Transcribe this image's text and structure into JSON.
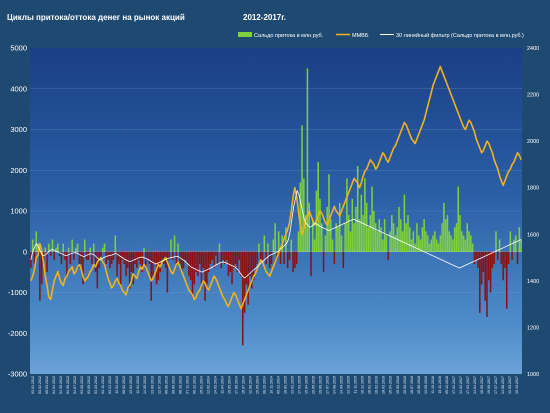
{
  "chart_data": {
    "type": "bar",
    "title": "Циклы притока/оттока денег на рынок акций",
    "subtitle": "2012-2017г.",
    "legend": {
      "placement": "top-right",
      "entries": [
        {
          "label": "Сальдо притока в млн.руб.",
          "color": "#7fd13b"
        },
        {
          "label": "ММВБ",
          "color": "#f2b21b"
        },
        {
          "label": "30 линейный фильтр (Сальдо притока в млн.руб.)",
          "color": "#ffffff"
        }
      ]
    },
    "y_left": {
      "ticks": [
        -3000,
        -2000,
        -1000,
        0,
        1000,
        2000,
        3000,
        4000,
        5000
      ],
      "ylim": [
        -3000,
        5000
      ]
    },
    "y_right": {
      "ticks": [
        1000,
        1200,
        1400,
        1600,
        1800,
        2000,
        2200,
        2400
      ],
      "ylim": [
        1000,
        2400
      ]
    },
    "x_ticks": [
      "03.01.2012",
      "03.02.2012",
      "05.03.2012",
      "04.04.2012",
      "04.05.2012",
      "04.06.2012",
      "04.07.2012",
      "03.08.2012",
      "03.09.2012",
      "03.10.2012",
      "02.11.2012",
      "03.12.2012",
      "11.01.2013",
      "08.02.2013",
      "13.03.2013",
      "11.04.2013",
      "14.05.2013",
      "13.06.2013",
      "12.07.2013",
      "09.08.2013",
      "09.09.2013",
      "08.10.2013",
      "07.11.2013",
      "09.12.2013",
      "15.01.2014",
      "12.02.2014",
      "14.03.2014",
      "11.04.2014",
      "15.05.2014",
      "17.06.2014",
      "15.07.2014",
      "12.08.2014",
      "10.09.2014",
      "08.10.2014",
      "10.11.2014",
      "09.12.2014",
      "16.01.2015",
      "13.02.2015",
      "17.03.2015",
      "15.04.2015",
      "20.05.2015",
      "19.06.2015",
      "17.07.2015",
      "14.08.2015",
      "14.09.2015",
      "12.10.2015",
      "11.11.2015",
      "10.12.2015",
      "18.01.2016",
      "16.02.2016",
      "18.03.2016",
      "15.04.2016",
      "19.05.2016",
      "20.06.2016",
      "18.07.2016",
      "15.08.2016",
      "13.09.2016",
      "11.10.2016",
      "10.11.2016",
      "09.12.2016",
      "17.01.2017",
      "14.02.2017",
      "17.03.2017",
      "14.04.2017",
      "18.05.2017",
      "19.06.2017",
      "17.07.2017",
      "14.08.2017",
      "12.09.2017",
      "10.10.2017"
    ],
    "series": [
      {
        "name": "Сальдо притока в млн.руб.",
        "axis": "left",
        "type": "bar",
        "positive_color": "#7fd13b",
        "negative_color": "#8b1010",
        "values": [
          -400,
          300,
          -300,
          500,
          200,
          -1200,
          -800,
          -200,
          100,
          -500,
          200,
          -100,
          300,
          -200,
          100,
          200,
          -100,
          -300,
          200,
          -200,
          -600,
          100,
          -300,
          300,
          -200,
          100,
          200,
          -400,
          -300,
          -800,
          300,
          -200,
          -200,
          100,
          -300,
          200,
          -500,
          -900,
          -400,
          -200,
          100,
          200,
          -300,
          -200,
          -400,
          -300,
          -200,
          400,
          -600,
          -300,
          -800,
          -200,
          -300,
          -600,
          -400,
          -900,
          -500,
          -800,
          -300,
          -400,
          -200,
          -300,
          -500,
          100,
          -400,
          -200,
          -300,
          -1200,
          -600,
          -300,
          -800,
          -700,
          -500,
          -200,
          -300,
          -400,
          -1000,
          -200,
          300,
          -200,
          400,
          -300,
          200,
          -300,
          -500,
          -400,
          -200,
          -300,
          -600,
          -700,
          -1100,
          -800,
          -500,
          -600,
          -300,
          -900,
          -400,
          -1200,
          -800,
          -500,
          -300,
          -200,
          -400,
          -100,
          -300,
          200,
          -400,
          -200,
          -300,
          -200,
          -600,
          -500,
          -800,
          -400,
          -300,
          -500,
          -200,
          -600,
          -2300,
          -1500,
          -800,
          -1300,
          -600,
          -900,
          -700,
          -400,
          -300,
          200,
          -300,
          -200,
          400,
          -300,
          200,
          -400,
          -300,
          300,
          700,
          -200,
          500,
          -300,
          400,
          -300,
          600,
          -400,
          -200,
          300,
          -500,
          -400,
          -300,
          500,
          1700,
          3100,
          1800,
          900,
          4500,
          1200,
          -600,
          800,
          300,
          1500,
          2200,
          1300,
          700,
          -500,
          400,
          1100,
          1900,
          800,
          300,
          -300,
          700,
          600,
          1200,
          400,
          -400,
          700,
          1800,
          900,
          500,
          1300,
          700,
          1100,
          2100,
          800,
          1400,
          900,
          1800,
          1200,
          600,
          900,
          1600,
          1000,
          700,
          500,
          800,
          600,
          300,
          800,
          400,
          -200,
          500,
          900,
          700,
          400,
          600,
          1100,
          800,
          500,
          1400,
          700,
          900,
          600,
          300,
          500,
          200,
          700,
          400,
          300,
          600,
          800,
          500,
          400,
          200,
          300,
          400,
          500,
          300,
          200,
          400,
          700,
          1200,
          800,
          900,
          500,
          400,
          300,
          600,
          700,
          1600,
          900,
          500,
          400,
          300,
          700,
          500,
          400,
          200,
          -300,
          -200,
          -400,
          -1500,
          -800,
          -500,
          -1200,
          -1600,
          -700,
          -1000,
          -400,
          -300,
          500,
          -200,
          300,
          -300,
          -700,
          -400,
          -1400,
          -300,
          500,
          -200,
          300,
          400,
          -300,
          600,
          300
        ]
      },
      {
        "name": "ММВБ",
        "axis": "right",
        "type": "line",
        "color": "#f2b21b",
        "values": [
          1400,
          1420,
          1450,
          1500,
          1510,
          1560,
          1530,
          1480,
          1420,
          1380,
          1330,
          1320,
          1360,
          1400,
          1420,
          1440,
          1410,
          1390,
          1380,
          1410,
          1420,
          1440,
          1450,
          1460,
          1430,
          1440,
          1460,
          1470,
          1450,
          1420,
          1400,
          1410,
          1420,
          1440,
          1450,
          1470,
          1460,
          1480,
          1490,
          1500,
          1480,
          1470,
          1440,
          1410,
          1390,
          1370,
          1380,
          1400,
          1410,
          1390,
          1380,
          1360,
          1350,
          1340,
          1370,
          1380,
          1400,
          1430,
          1420,
          1410,
          1440,
          1460,
          1450,
          1470,
          1460,
          1440,
          1420,
          1400,
          1410,
          1430,
          1450,
          1470,
          1460,
          1480,
          1490,
          1500,
          1480,
          1460,
          1440,
          1430,
          1450,
          1470,
          1480,
          1460,
          1440,
          1420,
          1400,
          1380,
          1360,
          1350,
          1340,
          1320,
          1330,
          1350,
          1360,
          1380,
          1400,
          1390,
          1370,
          1360,
          1380,
          1400,
          1420,
          1410,
          1390,
          1370,
          1350,
          1330,
          1320,
          1300,
          1290,
          1310,
          1330,
          1350,
          1340,
          1320,
          1300,
          1280,
          1300,
          1320,
          1340,
          1360,
          1380,
          1400,
          1420,
          1430,
          1450,
          1470,
          1490,
          1480,
          1460,
          1440,
          1430,
          1420,
          1440,
          1460,
          1480,
          1500,
          1520,
          1540,
          1560,
          1580,
          1600,
          1620,
          1650,
          1700,
          1760,
          1800,
          1760,
          1700,
          1640,
          1600,
          1620,
          1660,
          1680,
          1700,
          1680,
          1660,
          1640,
          1660,
          1680,
          1700,
          1690,
          1670,
          1650,
          1640,
          1660,
          1680,
          1700,
          1720,
          1700,
          1690,
          1680,
          1700,
          1720,
          1740,
          1760,
          1780,
          1800,
          1820,
          1840,
          1830,
          1820,
          1800,
          1820,
          1850,
          1870,
          1880,
          1900,
          1920,
          1910,
          1900,
          1880,
          1890,
          1910,
          1930,
          1950,
          1940,
          1920,
          1910,
          1930,
          1950,
          1970,
          1980,
          2000,
          2020,
          2040,
          2060,
          2080,
          2070,
          2050,
          2030,
          2010,
          2000,
          1990,
          2010,
          2030,
          2050,
          2070,
          2090,
          2120,
          2150,
          2180,
          2210,
          2240,
          2260,
          2280,
          2300,
          2320,
          2300,
          2280,
          2260,
          2240,
          2220,
          2200,
          2180,
          2160,
          2140,
          2120,
          2100,
          2080,
          2060,
          2050,
          2070,
          2090,
          2080,
          2060,
          2040,
          2010,
          1990,
          1970,
          1950,
          1960,
          1980,
          2000,
          1990,
          1970,
          1950,
          1920,
          1900,
          1880,
          1850,
          1830,
          1810,
          1830,
          1850,
          1870,
          1880,
          1900,
          1910,
          1930,
          1950,
          1940,
          1920
        ]
      },
      {
        "name": "30 линейный фильтр (Сальдо притока в млн.руб.)",
        "axis": "left",
        "type": "line",
        "color": "#ffffff",
        "values": [
          -200,
          0,
          100,
          200,
          150,
          50,
          -50,
          -100,
          -80,
          -50,
          0,
          30,
          60,
          40,
          20,
          0,
          -20,
          -40,
          -60,
          -80,
          -100,
          -80,
          -60,
          -40,
          -30,
          -20,
          -30,
          -50,
          -80,
          -100,
          -120,
          -100,
          -80,
          -60,
          -50,
          -60,
          -80,
          -120,
          -160,
          -200,
          -180,
          -150,
          -130,
          -110,
          -100,
          -90,
          -80,
          -60,
          -40,
          -60,
          -90,
          -120,
          -150,
          -180,
          -200,
          -220,
          -240,
          -230,
          -210,
          -190,
          -170,
          -150,
          -140,
          -130,
          -140,
          -160,
          -180,
          -200,
          -230,
          -260,
          -280,
          -300,
          -280,
          -260,
          -240,
          -220,
          -200,
          -180,
          -160,
          -150,
          -140,
          -130,
          -120,
          -110,
          -130,
          -160,
          -190,
          -220,
          -260,
          -300,
          -340,
          -380,
          -400,
          -420,
          -440,
          -460,
          -480,
          -500,
          -480,
          -460,
          -440,
          -420,
          -400,
          -380,
          -350,
          -320,
          -300,
          -280,
          -260,
          -250,
          -260,
          -280,
          -300,
          -320,
          -340,
          -360,
          -380,
          -420,
          -480,
          -540,
          -600,
          -640,
          -620,
          -580,
          -540,
          -500,
          -460,
          -420,
          -380,
          -340,
          -300,
          -260,
          -220,
          -180,
          -140,
          -100,
          -80,
          -60,
          -40,
          -20,
          0,
          40,
          80,
          120,
          160,
          200,
          300,
          500,
          800,
          1100,
          1300,
          1500,
          1400,
          1200,
          1000,
          800,
          700,
          650,
          600,
          620,
          650,
          700,
          680,
          650,
          620,
          600,
          580,
          560,
          540,
          520,
          540,
          560,
          580,
          600,
          620,
          640,
          660,
          680,
          700,
          720,
          740,
          760,
          780,
          800,
          780,
          760,
          740,
          720,
          700,
          680,
          660,
          640,
          620,
          600,
          580,
          560,
          540,
          520,
          500,
          480,
          460,
          440,
          420,
          400,
          380,
          360,
          340,
          320,
          300,
          280,
          260,
          240,
          220,
          200,
          180,
          160,
          140,
          120,
          100,
          80,
          60,
          40,
          20,
          0,
          -20,
          -40,
          -60,
          -80,
          -100,
          -120,
          -140,
          -160,
          -180,
          -200,
          -220,
          -240,
          -260,
          -280,
          -300,
          -320,
          -340,
          -360,
          -380,
          -400,
          -380,
          -360,
          -340,
          -320,
          -300,
          -280,
          -260,
          -240,
          -220,
          -200,
          -180,
          -160,
          -140,
          -120,
          -100,
          -80,
          -60,
          -40,
          -20,
          0,
          20,
          40,
          60,
          80,
          100,
          120,
          140,
          160,
          180,
          200,
          220,
          240,
          260,
          280,
          300
        ]
      }
    ],
    "grid": true
  }
}
